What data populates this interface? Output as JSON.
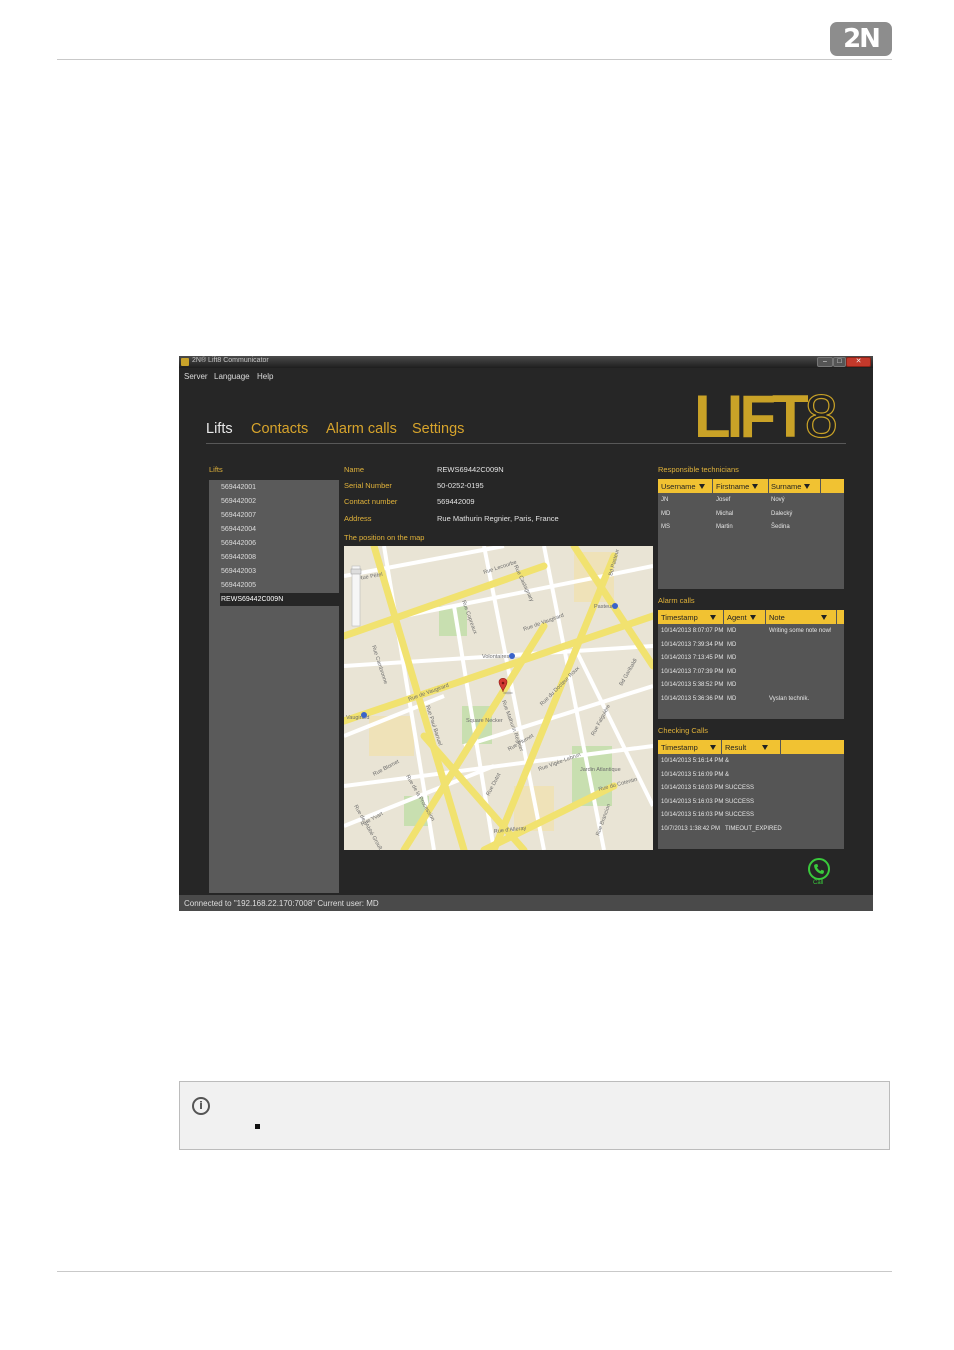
{
  "page": {
    "brand_logo": "2N"
  },
  "window": {
    "title": "2N® Lift8 Communicator",
    "controls": {
      "minimize": "–",
      "maximize": "□",
      "close": "✕"
    },
    "menu": [
      "Server",
      "Language",
      "Help"
    ],
    "brand": {
      "text": "LIFT",
      "number": "8"
    }
  },
  "tabs": [
    "Lifts",
    "Contacts",
    "Alarm calls",
    "Settings"
  ],
  "lifts": {
    "heading": "Lifts",
    "items": [
      "569442001",
      "569442002",
      "569442007",
      "569442004",
      "569442006",
      "569442008",
      "569442003",
      "569442005",
      "REWS69442C009N"
    ],
    "selected_index": 8
  },
  "details": {
    "name_label": "Name",
    "name_value": "REWS69442C009N",
    "serial_label": "Serial Number",
    "serial_value": "50-0252-0195",
    "contact_label": "Contact number",
    "contact_value": "569442009",
    "address_label": "Address",
    "address_value": "Rue Mathurin Regnier, Paris, France",
    "map_heading": "The position on the map"
  },
  "map": {
    "streets": [
      "Rue Lecourbe",
      "Rue de Vaugirard",
      "Rue Cambronne",
      "Rue Paul Barruel",
      "Rue Dutot",
      "Rue du Docteur Roux",
      "Rue Falguière",
      "Rue d'Alleray",
      "Rue Vigée-Lebrun",
      "Rue du Cotentin",
      "Rue Pétel",
      "Rue Mathurin Regnier",
      "Rue Plumet",
      "Bd Pasteur",
      "Rue Blomet",
      "Rue Yvart",
      "Rue Brancion",
      "Rue de la Procession",
      "Rue de l'Abbé Groult",
      "Rue Castagnary",
      "Rue Copreaux",
      "Rue Alexandre Cabanel",
      "Bd Garibaldi"
    ],
    "places": [
      "Volontaires",
      "Pasteur",
      "Vaugirard",
      "Pl. Adolphe Chérioux",
      "Square Necker",
      "Jardin Atlantique"
    ]
  },
  "technicians": {
    "heading": "Responsible technicians",
    "columns": [
      "Username",
      "Firstname",
      "Surname"
    ],
    "rows": [
      [
        "JN",
        "Josef",
        "Nový"
      ],
      [
        "MD",
        "Michal",
        "Dalecký"
      ],
      [
        "MS",
        "Martin",
        "Šedina"
      ]
    ]
  },
  "alarm_calls": {
    "heading": "Alarm calls",
    "columns": [
      "Timestamp",
      "Agent",
      "Note"
    ],
    "rows": [
      [
        "10/14/2013 8:07:07 PM",
        "MD",
        "Writing some note now!"
      ],
      [
        "10/14/2013 7:39:34 PM",
        "MD",
        ""
      ],
      [
        "10/14/2013 7:13:45 PM",
        "MD",
        ""
      ],
      [
        "10/14/2013 7:07:39 PM",
        "MD",
        ""
      ],
      [
        "10/14/2013 5:38:52 PM",
        "MD",
        ""
      ],
      [
        "10/14/2013 5:36:36 PM",
        "MD",
        "Vyslan technik."
      ]
    ]
  },
  "checking_calls": {
    "heading": "Checking Calls",
    "columns": [
      "Timestamp",
      "Result"
    ],
    "rows": [
      [
        "10/14/2013 5:16:14 PM",
        "&"
      ],
      [
        "10/14/2013 5:16:09 PM",
        "&"
      ],
      [
        "10/14/2013 5:16:03 PM",
        "SUCCESS"
      ],
      [
        "10/14/2013 5:16:03 PM",
        "SUCCESS"
      ],
      [
        "10/14/2013 5:16:03 PM",
        "SUCCESS"
      ],
      [
        "10/7/2013 1:38:42 PM",
        "TIMEOUT_EXPIRED"
      ]
    ]
  },
  "call_button": {
    "label": "Call",
    "icon": "phone-icon"
  },
  "status": "Connected to \"192.168.22.170:7008\"   Current user: MD",
  "info_box": {
    "icon": "info-icon"
  },
  "colors": {
    "accent": "#e0b23a",
    "header": "#f1c232",
    "background": "#262626",
    "call": "#39c93b"
  }
}
